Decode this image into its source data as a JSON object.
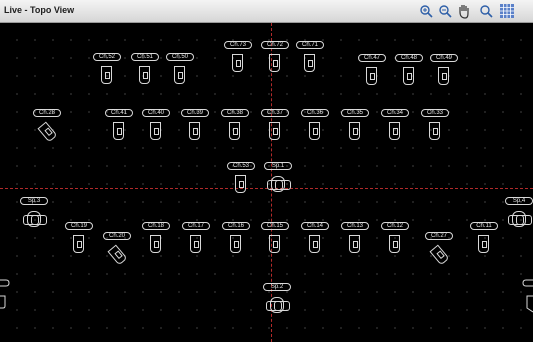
{
  "window": {
    "title": "Live - Topo View"
  },
  "toolbar": {
    "tools": [
      "zoom-in-icon",
      "zoom-out-icon",
      "pan-hand-icon",
      "zoom-fit-icon",
      "grid-icon"
    ]
  },
  "devices": [
    {
      "label": "Ch.73"
    },
    {
      "label": "Ch.72"
    },
    {
      "label": "Ch.71"
    },
    {
      "label": "Ch.52"
    },
    {
      "label": "Ch.51"
    },
    {
      "label": "Ch.50"
    },
    {
      "label": "Ch.47"
    },
    {
      "label": "Ch.48"
    },
    {
      "label": "Ch.49"
    },
    {
      "label": "Ch.28"
    },
    {
      "label": "Ch.41"
    },
    {
      "label": "Ch.40"
    },
    {
      "label": "Ch.39"
    },
    {
      "label": "Ch.38"
    },
    {
      "label": "Ch.37"
    },
    {
      "label": "Ch.36"
    },
    {
      "label": "Ch.35"
    },
    {
      "label": "Ch.34"
    },
    {
      "label": "Ch.33"
    },
    {
      "label": "Ch.53"
    },
    {
      "label": "Sp.1"
    },
    {
      "label": "Sp.3"
    },
    {
      "label": "Sp.4"
    },
    {
      "label": "Ch.19"
    },
    {
      "label": "Ch.20"
    },
    {
      "label": "Ch.18"
    },
    {
      "label": "Ch.17"
    },
    {
      "label": "Ch.16"
    },
    {
      "label": "Ch.15"
    },
    {
      "label": "Ch.14"
    },
    {
      "label": "Ch.13"
    },
    {
      "label": "Ch.12"
    },
    {
      "label": "Ch.27"
    },
    {
      "label": "Ch.11"
    },
    {
      "label": "Sp.2"
    }
  ]
}
